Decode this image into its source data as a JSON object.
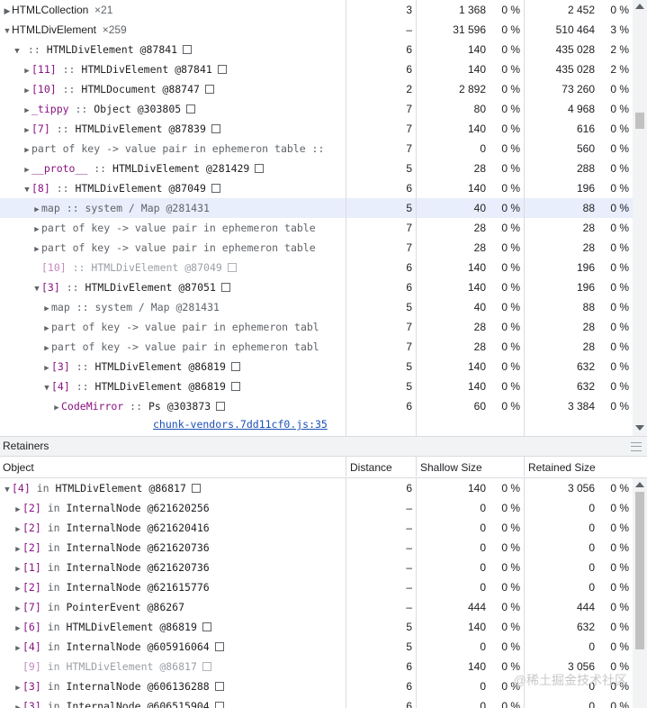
{
  "top_rows": [
    {
      "indent": 0,
      "tri": "r",
      "kind": "group",
      "label": "HTMLCollection",
      "count": "×21",
      "dist": "3",
      "sh": "1 368",
      "shp": "0 %",
      "rt": "2 452",
      "rtp": "0 %"
    },
    {
      "indent": 0,
      "tri": "d",
      "kind": "group",
      "label": "HTMLDivElement",
      "count": "×259",
      "dist": "–",
      "sh": "31 596",
      "shp": "0 %",
      "rt": "510 464",
      "rtp": "3 %"
    },
    {
      "indent": 1,
      "tri": "d",
      "kind": "node",
      "cls": "HTMLDivElement @87841",
      "box": true,
      "dist": "6",
      "sh": "140",
      "shp": "0 %",
      "rt": "435 028",
      "rtp": "2 %"
    },
    {
      "indent": 2,
      "tri": "r",
      "kind": "node",
      "edge": "[11]",
      "cls": "HTMLDivElement @87841",
      "box": true,
      "dist": "6",
      "sh": "140",
      "shp": "0 %",
      "rt": "435 028",
      "rtp": "2 %"
    },
    {
      "indent": 2,
      "tri": "r",
      "kind": "node",
      "edge": "[10]",
      "cls": "HTMLDocument @88747",
      "box": true,
      "dist": "2",
      "sh": "2 892",
      "shp": "0 %",
      "rt": "73 260",
      "rtp": "0 %"
    },
    {
      "indent": 2,
      "tri": "r",
      "kind": "node",
      "edge": "_tippy",
      "cls": "Object @303805",
      "box": true,
      "dist": "7",
      "sh": "80",
      "shp": "0 %",
      "rt": "4 968",
      "rtp": "0 %"
    },
    {
      "indent": 2,
      "tri": "r",
      "kind": "node",
      "edge": "[7]",
      "cls": "HTMLDivElement @87839",
      "box": true,
      "dist": "7",
      "sh": "140",
      "shp": "0 %",
      "rt": "616",
      "rtp": "0 %"
    },
    {
      "indent": 2,
      "tri": "r",
      "kind": "key",
      "text": "part of key -> value pair in ephemeron table ::",
      "dist": "7",
      "sh": "0",
      "shp": "0 %",
      "rt": "560",
      "rtp": "0 %"
    },
    {
      "indent": 2,
      "tri": "r",
      "kind": "node",
      "edge": "__proto__",
      "cls": "HTMLDivElement @281429",
      "box": true,
      "dist": "5",
      "sh": "28",
      "shp": "0 %",
      "rt": "288",
      "rtp": "0 %"
    },
    {
      "indent": 2,
      "tri": "d",
      "kind": "node",
      "edge": "[8]",
      "cls": "HTMLDivElement @87049",
      "box": true,
      "dist": "6",
      "sh": "140",
      "shp": "0 %",
      "rt": "196",
      "rtp": "0 %"
    },
    {
      "indent": 3,
      "tri": "r",
      "kind": "key",
      "text": "map :: system / Map @281431",
      "dist": "5",
      "sh": "40",
      "shp": "0 %",
      "rt": "88",
      "rtp": "0 %",
      "sel": true
    },
    {
      "indent": 3,
      "tri": "r",
      "kind": "key",
      "text": "part of key -> value pair in ephemeron table",
      "dist": "7",
      "sh": "28",
      "shp": "0 %",
      "rt": "28",
      "rtp": "0 %"
    },
    {
      "indent": 3,
      "tri": "r",
      "kind": "key",
      "text": "part of key -> value pair in ephemeron table",
      "dist": "7",
      "sh": "28",
      "shp": "0 %",
      "rt": "28",
      "rtp": "0 %"
    },
    {
      "indent": 3,
      "tri": "",
      "kind": "node",
      "dim": true,
      "edge": "[10]",
      "cls": "HTMLDivElement @87049",
      "box": true,
      "dist": "6",
      "sh": "140",
      "shp": "0 %",
      "rt": "196",
      "rtp": "0 %"
    },
    {
      "indent": 3,
      "tri": "d",
      "kind": "node",
      "edge": "[3]",
      "cls": "HTMLDivElement @87051",
      "box": true,
      "dist": "6",
      "sh": "140",
      "shp": "0 %",
      "rt": "196",
      "rtp": "0 %"
    },
    {
      "indent": 4,
      "tri": "r",
      "kind": "key",
      "text": "map :: system / Map @281431",
      "dist": "5",
      "sh": "40",
      "shp": "0 %",
      "rt": "88",
      "rtp": "0 %"
    },
    {
      "indent": 4,
      "tri": "r",
      "kind": "key",
      "text": "part of key -> value pair in ephemeron tabl",
      "dist": "7",
      "sh": "28",
      "shp": "0 %",
      "rt": "28",
      "rtp": "0 %"
    },
    {
      "indent": 4,
      "tri": "r",
      "kind": "key",
      "text": "part of key -> value pair in ephemeron tabl",
      "dist": "7",
      "sh": "28",
      "shp": "0 %",
      "rt": "28",
      "rtp": "0 %"
    },
    {
      "indent": 4,
      "tri": "r",
      "kind": "node",
      "edge": "[3]",
      "cls": "HTMLDivElement @86819",
      "box": true,
      "dist": "5",
      "sh": "140",
      "shp": "0 %",
      "rt": "632",
      "rtp": "0 %"
    },
    {
      "indent": 4,
      "tri": "d",
      "kind": "node",
      "edge": "[4]",
      "cls": "HTMLDivElement @86819",
      "box": true,
      "dist": "5",
      "sh": "140",
      "shp": "0 %",
      "rt": "632",
      "rtp": "0 %"
    },
    {
      "indent": 5,
      "tri": "r",
      "kind": "node",
      "edge": "CodeMirror",
      "cls": "Ps @303873",
      "box": true,
      "dist": "6",
      "sh": "60",
      "shp": "0 %",
      "rt": "3 384",
      "rtp": "0 %"
    }
  ],
  "top_link": "chunk-vendors.7dd11cf0.js:35",
  "retainers_title": "Retainers",
  "headers": {
    "object": "Object",
    "distance": "Distance",
    "shallow": "Shallow Size",
    "retained": "Retained Size"
  },
  "bottom_rows": [
    {
      "indent": 0,
      "tri": "d",
      "kind": "ret",
      "edge": "[4]",
      "cls": "HTMLDivElement @86817",
      "box": true,
      "dist": "6",
      "sh": "140",
      "shp": "0 %",
      "rt": "3 056",
      "rtp": "0 %"
    },
    {
      "indent": 1,
      "tri": "r",
      "kind": "ret",
      "edge": "[2]",
      "cls": "InternalNode @621620256",
      "dist": "–",
      "sh": "0",
      "shp": "0 %",
      "rt": "0",
      "rtp": "0 %"
    },
    {
      "indent": 1,
      "tri": "r",
      "kind": "ret",
      "edge": "[2]",
      "cls": "InternalNode @621620416",
      "dist": "–",
      "sh": "0",
      "shp": "0 %",
      "rt": "0",
      "rtp": "0 %"
    },
    {
      "indent": 1,
      "tri": "r",
      "kind": "ret",
      "edge": "[2]",
      "cls": "InternalNode @621620736",
      "dist": "–",
      "sh": "0",
      "shp": "0 %",
      "rt": "0",
      "rtp": "0 %"
    },
    {
      "indent": 1,
      "tri": "r",
      "kind": "ret",
      "edge": "[1]",
      "cls": "InternalNode @621620736",
      "dist": "–",
      "sh": "0",
      "shp": "0 %",
      "rt": "0",
      "rtp": "0 %"
    },
    {
      "indent": 1,
      "tri": "r",
      "kind": "ret",
      "edge": "[2]",
      "cls": "InternalNode @621615776",
      "dist": "–",
      "sh": "0",
      "shp": "0 %",
      "rt": "0",
      "rtp": "0 %"
    },
    {
      "indent": 1,
      "tri": "r",
      "kind": "ret",
      "edge": "[7]",
      "cls": "PointerEvent @86267",
      "dist": "–",
      "sh": "444",
      "shp": "0 %",
      "rt": "444",
      "rtp": "0 %"
    },
    {
      "indent": 1,
      "tri": "r",
      "kind": "ret",
      "edge": "[6]",
      "cls": "HTMLDivElement @86819",
      "box": true,
      "dist": "5",
      "sh": "140",
      "shp": "0 %",
      "rt": "632",
      "rtp": "0 %"
    },
    {
      "indent": 1,
      "tri": "r",
      "kind": "ret",
      "edge": "[4]",
      "cls": "InternalNode @605916064",
      "box": true,
      "dist": "5",
      "sh": "0",
      "shp": "0 %",
      "rt": "0",
      "rtp": "0 %"
    },
    {
      "indent": 1,
      "tri": "",
      "kind": "ret",
      "dim": true,
      "edge": "[9]",
      "cls": "HTMLDivElement @86817",
      "box": true,
      "dist": "6",
      "sh": "140",
      "shp": "0 %",
      "rt": "3 056",
      "rtp": "0 %"
    },
    {
      "indent": 1,
      "tri": "r",
      "kind": "ret",
      "edge": "[3]",
      "cls": "InternalNode @606136288",
      "box": true,
      "dist": "6",
      "sh": "0",
      "shp": "0 %",
      "rt": "0",
      "rtp": "0 %"
    },
    {
      "indent": 1,
      "tri": "r",
      "kind": "ret",
      "edge": "[3]",
      "cls": "InternalNode @606515904",
      "box": true,
      "dist": "6",
      "sh": "0",
      "shp": "0 %",
      "rt": "0",
      "rtp": "0 %"
    }
  ],
  "watermark": "@稀土掘金技术社区"
}
